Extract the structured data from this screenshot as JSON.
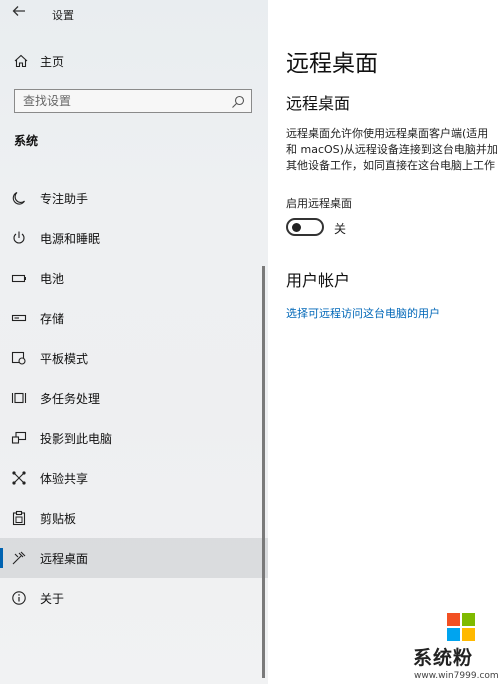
{
  "window": {
    "title": "设置"
  },
  "sidebar": {
    "home_label": "主页",
    "search_placeholder": "查找设置",
    "section_title": "系统",
    "items": [
      {
        "label": "专注助手",
        "icon": "moon-icon"
      },
      {
        "label": "电源和睡眠",
        "icon": "power-icon"
      },
      {
        "label": "电池",
        "icon": "battery-icon"
      },
      {
        "label": "存储",
        "icon": "storage-icon"
      },
      {
        "label": "平板模式",
        "icon": "tablet-mode-icon"
      },
      {
        "label": "多任务处理",
        "icon": "multitasking-icon"
      },
      {
        "label": "投影到此电脑",
        "icon": "projecting-icon"
      },
      {
        "label": "体验共享",
        "icon": "shared-experiences-icon"
      },
      {
        "label": "剪贴板",
        "icon": "clipboard-icon"
      },
      {
        "label": "远程桌面",
        "icon": "remote-desktop-icon",
        "active": true
      },
      {
        "label": "关于",
        "icon": "info-icon"
      }
    ]
  },
  "main": {
    "page_title": "远程桌面",
    "sub_title": "远程桌面",
    "description_lines": [
      "远程桌面允许你使用远程桌面客户端(适用",
      "和 macOS)从远程设备连接到这台电脑并加",
      "其他设备工作，如同直接在这台电脑上工作"
    ],
    "toggle_label": "启用远程桌面",
    "toggle_state": "关",
    "toggle_on": false,
    "accounts_title": "用户帐户",
    "accounts_link": "选择可远程访问这台电脑的用户"
  },
  "watermark": {
    "text": "系统粉",
    "url": "www.win7999.com"
  },
  "colors": {
    "accent": "#0063b1",
    "link": "#0067b8",
    "logo": [
      "#f25022",
      "#7fba00",
      "#00a4ef",
      "#ffb900"
    ]
  }
}
